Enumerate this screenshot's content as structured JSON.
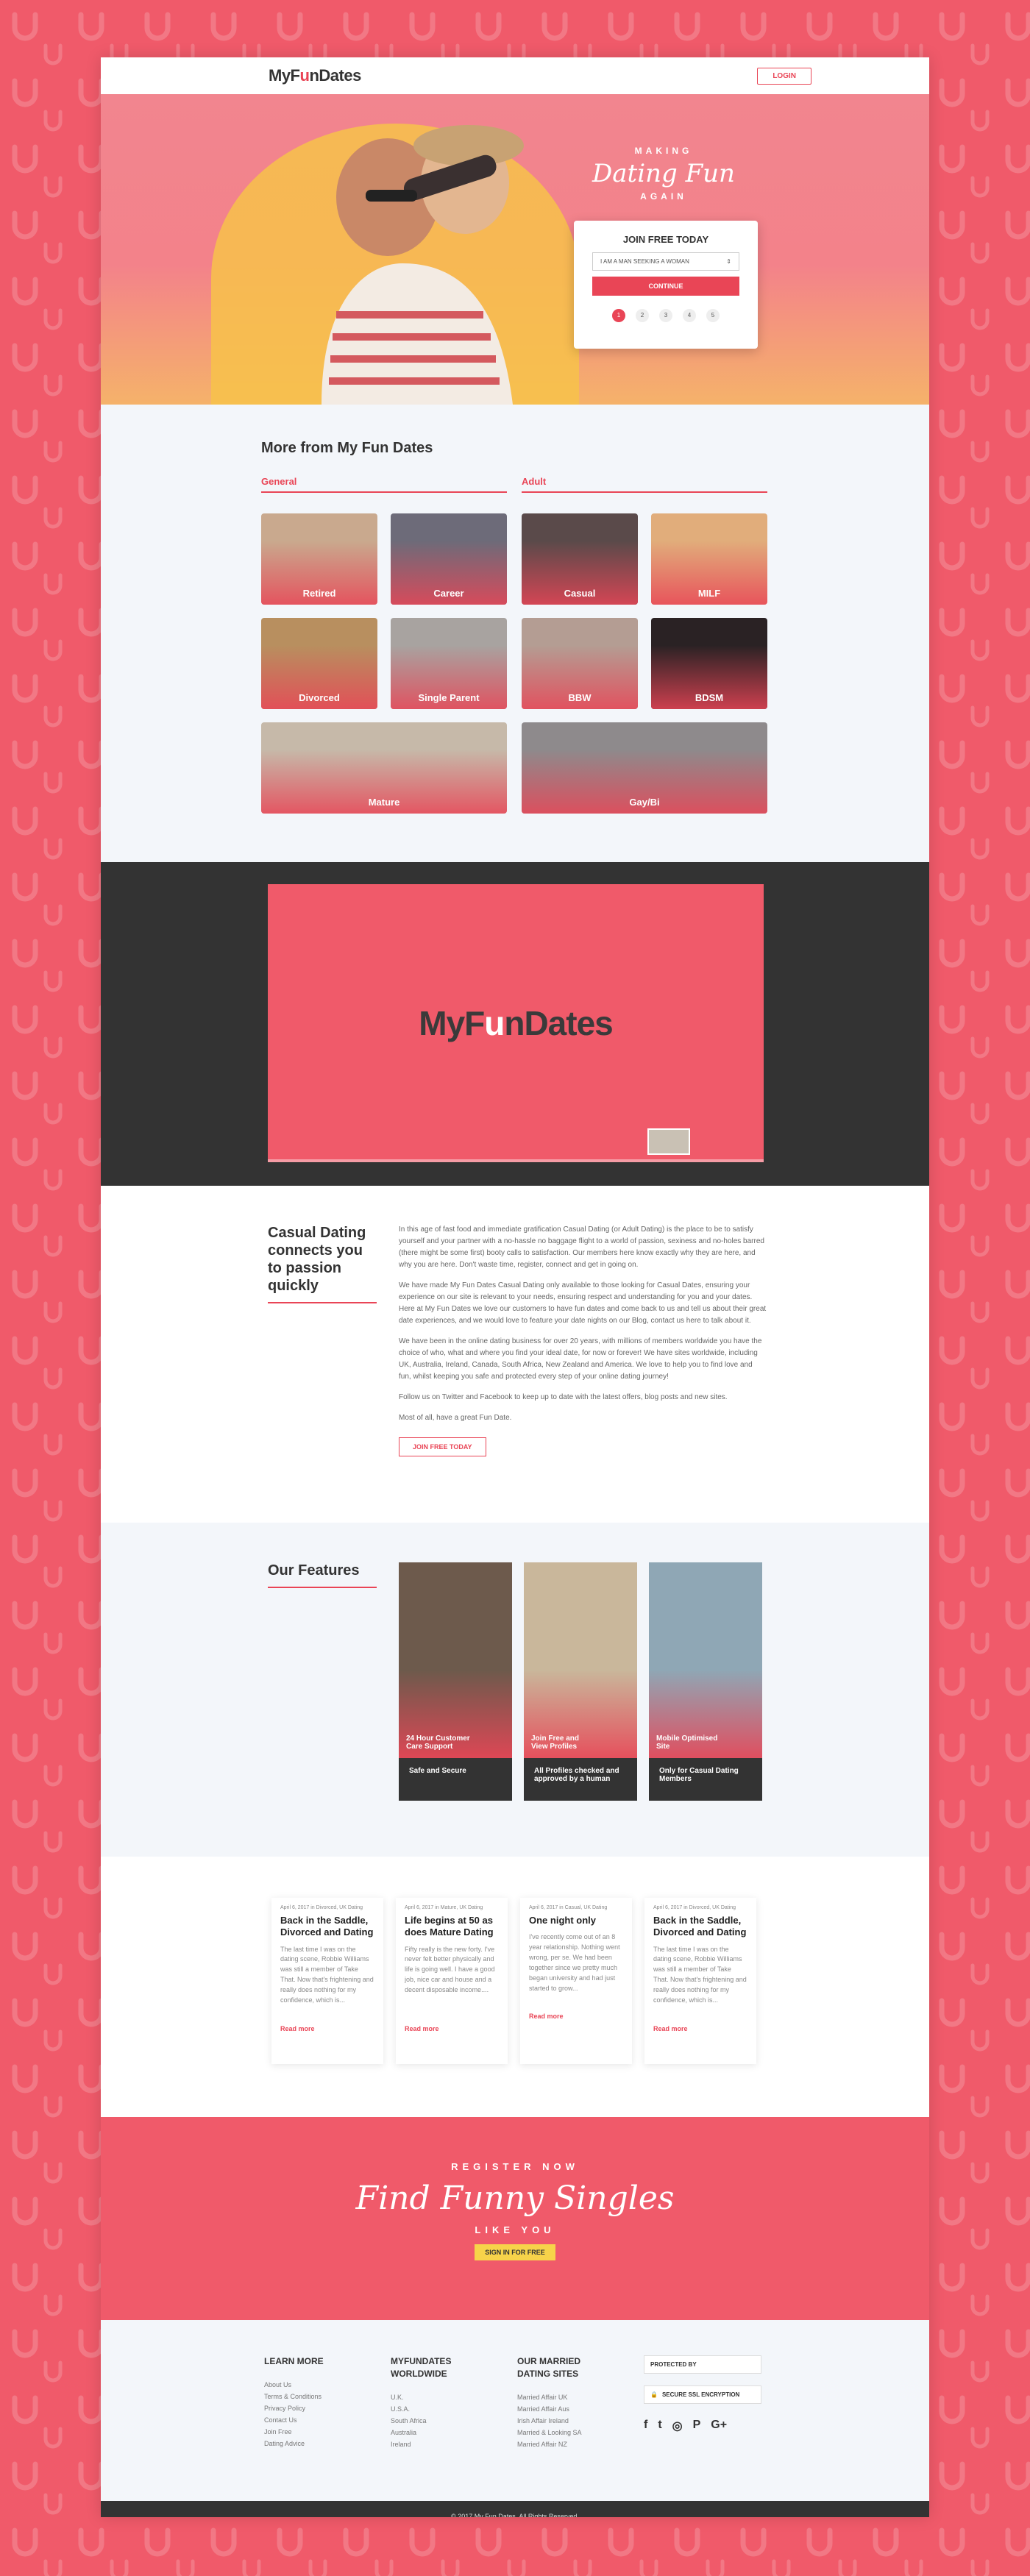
{
  "header": {
    "logo_pre": "MyF",
    "logo_mid": "u",
    "logo_post": "nDates",
    "login": "LOGIN"
  },
  "hero": {
    "making": "MAKING",
    "script": "Dating Fun",
    "again": "AGAIN",
    "join_title": "JOIN FREE TODAY",
    "select_value": "I AM A MAN SEEKING A WOMAN",
    "continue": "CONTINUE",
    "steps": [
      "1",
      "2",
      "3",
      "4",
      "5"
    ]
  },
  "more": {
    "title": "More from My Fun Dates",
    "general_label": "General",
    "adult_label": "Adult",
    "general": [
      "Retired",
      "Career",
      "Divorced",
      "Single Parent",
      "Mature"
    ],
    "adult": [
      "Casual",
      "MILF",
      "BBW",
      "BDSM",
      "Gay/Bi"
    ]
  },
  "video": {
    "logo_pre": "MyF",
    "logo_mid": "u",
    "logo_post": "nDates"
  },
  "casual": {
    "title": "Casual Dating connects you to passion quickly",
    "paragraphs": [
      "In this age of fast food and immediate gratification Casual Dating (or Adult Dating) is the place to be to satisfy yourself and your partner with a no-hassle no baggage flight to a world of passion, sexiness and no-holes barred (there might be some first) booty calls to satisfaction. Our members here know exactly why they are here, and why you are here. Don't waste time, register, connect and get in going on.",
      "We have made My Fun Dates Casual Dating only available to those looking for Casual Dates, ensuring your experience on our site is relevant to your needs, ensuring respect and understanding for you and your dates. Here at My Fun Dates we love our customers to have fun dates and come back to us and tell us about their great date experiences, and we would love to feature your date nights on our Blog, contact us here to talk about it.",
      "We have been in the online dating business for over 20 years, with millions of members worldwide you have the choice of who, what and where you find your ideal date, for now or forever! We have sites worldwide, including UK, Australia, Ireland, Canada, South Africa, New Zealand and America. We love to help you to find love and fun, whilst keeping you safe and protected every step of your online dating journey!",
      "Follow us on Twitter and Facebook to keep up to date with the latest offers, blog posts and new sites.",
      "Most of all, have a great Fun Date."
    ],
    "button": "JOIN FREE TODAY"
  },
  "features": {
    "title": "Our Features",
    "cards": [
      {
        "top": "24 Hour Customer Care Support",
        "bottom": "Safe and Secure"
      },
      {
        "top": "Join Free and View Profiles",
        "bottom": "All Profiles checked and approved by a human"
      },
      {
        "top": "Mobile Optimised Site",
        "bottom": "Only for Casual Dating Members"
      }
    ]
  },
  "blog": {
    "posts": [
      {
        "meta": "April 6, 2017 in Divorced, UK Dating",
        "title": "Back in the Saddle, Divorced and Dating",
        "excerpt": "The last time I was on the dating scene, Robbie Williams was still a member of Take That. Now that's frightening and really does nothing for my confidence, which is...",
        "link": "Read more"
      },
      {
        "meta": "April 6, 2017 in Mature, UK Dating",
        "title": "Life begins at 50 as does Mature Dating",
        "excerpt": "Fifty really is the new forty. I've never felt better physically and life is going well. I have a good job, nice car and house and a decent disposable income....",
        "link": "Read more"
      },
      {
        "meta": "April 6, 2017 in Casual, UK Dating",
        "title": "One night only",
        "excerpt": "I've recently come out of an 8 year relationship. Nothing went wrong, per se. We had been together since we pretty much began university and had just started to grow...",
        "link": "Read more"
      },
      {
        "meta": "April 6, 2017 in Divorced, UK Dating",
        "title": "Back in the Saddle, Divorced and Dating",
        "excerpt": "The last time I was on the dating scene, Robbie Williams was still a member of Take That. Now that's frightening and really does nothing for my confidence, which is...",
        "link": "Read more"
      }
    ]
  },
  "register": {
    "small": "REGISTER NOW",
    "script": "Find Funny Singles",
    "like": "LIKE YOU",
    "button": "SIGN IN FOR FREE"
  },
  "footer": {
    "col1_title": "LEARN MORE",
    "col1": [
      "About Us",
      "Terms & Conditions",
      "Privacy Policy",
      "Contact Us",
      "Join Free",
      "Dating Advice"
    ],
    "col2_title": "MYFUNDATES WORLDWIDE",
    "col2": [
      "U.K.",
      "U.S.A.",
      "South Africa",
      "Australia",
      "Ireland"
    ],
    "col3_title": "OUR MARRIED DATING SITES",
    "col3": [
      "Married Affair UK",
      "Married Affair Aus",
      "Irish Affair Ireland",
      "Married & Looking SA",
      "Married Affair NZ"
    ],
    "badge1": "PROTECTED BY",
    "badge2": "SECURE SSL ENCRYPTION",
    "social": [
      "f",
      "t",
      "◎",
      "P",
      "G+"
    ],
    "copyright": "© 2017 My Fun Dates. All Rights Reserved."
  },
  "colors": {
    "accent": "#e94556",
    "hero_pink": "#f05a6a",
    "yellow": "#f7d34a",
    "dark": "#333333"
  }
}
